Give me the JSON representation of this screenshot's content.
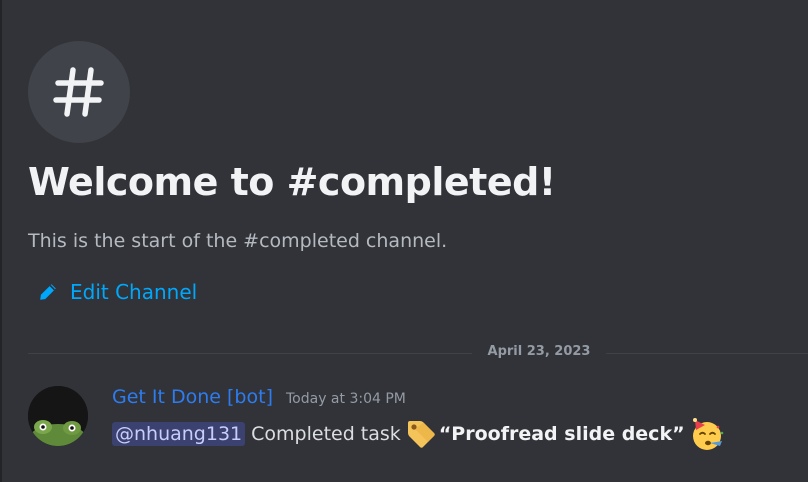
{
  "channel": {
    "icon": "hash-icon",
    "welcome_title": "Welcome to #completed!",
    "welcome_subtitle": "This is the start of the #completed channel.",
    "edit_label": "Edit Channel",
    "edit_icon": "pencil-icon"
  },
  "divider": {
    "date": "April 23, 2023"
  },
  "message": {
    "author": "Get It Done [bot]",
    "timestamp": "Today at 3:04 PM",
    "mention": "@nhuang131",
    "text": "Completed task",
    "task_emoji": "label-tag-emoji",
    "task_title": "“Proofread slide deck”",
    "end_emoji": "partying-face-emoji"
  },
  "colors": {
    "background": "#313338",
    "link": "#00a8fc",
    "author": "#2d7cf0",
    "mention_bg": "#3c4270"
  }
}
